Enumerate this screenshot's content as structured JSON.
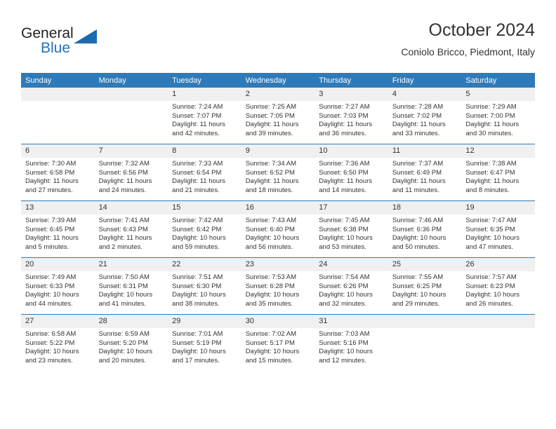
{
  "brand": {
    "name_top": "General",
    "name_bottom": "Blue",
    "accent_color": "#1a6bb0"
  },
  "header": {
    "title": "October 2024",
    "subtitle": "Coniolo Bricco, Piedmont, Italy"
  },
  "theme": {
    "header_blue": "#2f7ab8",
    "daynum_background": "#f0f0f0",
    "text_color": "#333333"
  },
  "weekday_headers": [
    "Sunday",
    "Monday",
    "Tuesday",
    "Wednesday",
    "Thursday",
    "Friday",
    "Saturday"
  ],
  "weeks": [
    [
      {
        "day": "",
        "lines": []
      },
      {
        "day": "",
        "lines": []
      },
      {
        "day": "1",
        "lines": [
          "Sunrise: 7:24 AM",
          "Sunset: 7:07 PM",
          "Daylight: 11 hours",
          "and 42 minutes."
        ]
      },
      {
        "day": "2",
        "lines": [
          "Sunrise: 7:25 AM",
          "Sunset: 7:05 PM",
          "Daylight: 11 hours",
          "and 39 minutes."
        ]
      },
      {
        "day": "3",
        "lines": [
          "Sunrise: 7:27 AM",
          "Sunset: 7:03 PM",
          "Daylight: 11 hours",
          "and 36 minutes."
        ]
      },
      {
        "day": "4",
        "lines": [
          "Sunrise: 7:28 AM",
          "Sunset: 7:02 PM",
          "Daylight: 11 hours",
          "and 33 minutes."
        ]
      },
      {
        "day": "5",
        "lines": [
          "Sunrise: 7:29 AM",
          "Sunset: 7:00 PM",
          "Daylight: 11 hours",
          "and 30 minutes."
        ]
      }
    ],
    [
      {
        "day": "6",
        "lines": [
          "Sunrise: 7:30 AM",
          "Sunset: 6:58 PM",
          "Daylight: 11 hours",
          "and 27 minutes."
        ]
      },
      {
        "day": "7",
        "lines": [
          "Sunrise: 7:32 AM",
          "Sunset: 6:56 PM",
          "Daylight: 11 hours",
          "and 24 minutes."
        ]
      },
      {
        "day": "8",
        "lines": [
          "Sunrise: 7:33 AM",
          "Sunset: 6:54 PM",
          "Daylight: 11 hours",
          "and 21 minutes."
        ]
      },
      {
        "day": "9",
        "lines": [
          "Sunrise: 7:34 AM",
          "Sunset: 6:52 PM",
          "Daylight: 11 hours",
          "and 18 minutes."
        ]
      },
      {
        "day": "10",
        "lines": [
          "Sunrise: 7:36 AM",
          "Sunset: 6:50 PM",
          "Daylight: 11 hours",
          "and 14 minutes."
        ]
      },
      {
        "day": "11",
        "lines": [
          "Sunrise: 7:37 AM",
          "Sunset: 6:49 PM",
          "Daylight: 11 hours",
          "and 11 minutes."
        ]
      },
      {
        "day": "12",
        "lines": [
          "Sunrise: 7:38 AM",
          "Sunset: 6:47 PM",
          "Daylight: 11 hours",
          "and 8 minutes."
        ]
      }
    ],
    [
      {
        "day": "13",
        "lines": [
          "Sunrise: 7:39 AM",
          "Sunset: 6:45 PM",
          "Daylight: 11 hours",
          "and 5 minutes."
        ]
      },
      {
        "day": "14",
        "lines": [
          "Sunrise: 7:41 AM",
          "Sunset: 6:43 PM",
          "Daylight: 11 hours",
          "and 2 minutes."
        ]
      },
      {
        "day": "15",
        "lines": [
          "Sunrise: 7:42 AM",
          "Sunset: 6:42 PM",
          "Daylight: 10 hours",
          "and 59 minutes."
        ]
      },
      {
        "day": "16",
        "lines": [
          "Sunrise: 7:43 AM",
          "Sunset: 6:40 PM",
          "Daylight: 10 hours",
          "and 56 minutes."
        ]
      },
      {
        "day": "17",
        "lines": [
          "Sunrise: 7:45 AM",
          "Sunset: 6:38 PM",
          "Daylight: 10 hours",
          "and 53 minutes."
        ]
      },
      {
        "day": "18",
        "lines": [
          "Sunrise: 7:46 AM",
          "Sunset: 6:36 PM",
          "Daylight: 10 hours",
          "and 50 minutes."
        ]
      },
      {
        "day": "19",
        "lines": [
          "Sunrise: 7:47 AM",
          "Sunset: 6:35 PM",
          "Daylight: 10 hours",
          "and 47 minutes."
        ]
      }
    ],
    [
      {
        "day": "20",
        "lines": [
          "Sunrise: 7:49 AM",
          "Sunset: 6:33 PM",
          "Daylight: 10 hours",
          "and 44 minutes."
        ]
      },
      {
        "day": "21",
        "lines": [
          "Sunrise: 7:50 AM",
          "Sunset: 6:31 PM",
          "Daylight: 10 hours",
          "and 41 minutes."
        ]
      },
      {
        "day": "22",
        "lines": [
          "Sunrise: 7:51 AM",
          "Sunset: 6:30 PM",
          "Daylight: 10 hours",
          "and 38 minutes."
        ]
      },
      {
        "day": "23",
        "lines": [
          "Sunrise: 7:53 AM",
          "Sunset: 6:28 PM",
          "Daylight: 10 hours",
          "and 35 minutes."
        ]
      },
      {
        "day": "24",
        "lines": [
          "Sunrise: 7:54 AM",
          "Sunset: 6:26 PM",
          "Daylight: 10 hours",
          "and 32 minutes."
        ]
      },
      {
        "day": "25",
        "lines": [
          "Sunrise: 7:55 AM",
          "Sunset: 6:25 PM",
          "Daylight: 10 hours",
          "and 29 minutes."
        ]
      },
      {
        "day": "26",
        "lines": [
          "Sunrise: 7:57 AM",
          "Sunset: 6:23 PM",
          "Daylight: 10 hours",
          "and 26 minutes."
        ]
      }
    ],
    [
      {
        "day": "27",
        "lines": [
          "Sunrise: 6:58 AM",
          "Sunset: 5:22 PM",
          "Daylight: 10 hours",
          "and 23 minutes."
        ]
      },
      {
        "day": "28",
        "lines": [
          "Sunrise: 6:59 AM",
          "Sunset: 5:20 PM",
          "Daylight: 10 hours",
          "and 20 minutes."
        ]
      },
      {
        "day": "29",
        "lines": [
          "Sunrise: 7:01 AM",
          "Sunset: 5:19 PM",
          "Daylight: 10 hours",
          "and 17 minutes."
        ]
      },
      {
        "day": "30",
        "lines": [
          "Sunrise: 7:02 AM",
          "Sunset: 5:17 PM",
          "Daylight: 10 hours",
          "and 15 minutes."
        ]
      },
      {
        "day": "31",
        "lines": [
          "Sunrise: 7:03 AM",
          "Sunset: 5:16 PM",
          "Daylight: 10 hours",
          "and 12 minutes."
        ]
      },
      {
        "day": "",
        "lines": []
      },
      {
        "day": "",
        "lines": []
      }
    ]
  ]
}
